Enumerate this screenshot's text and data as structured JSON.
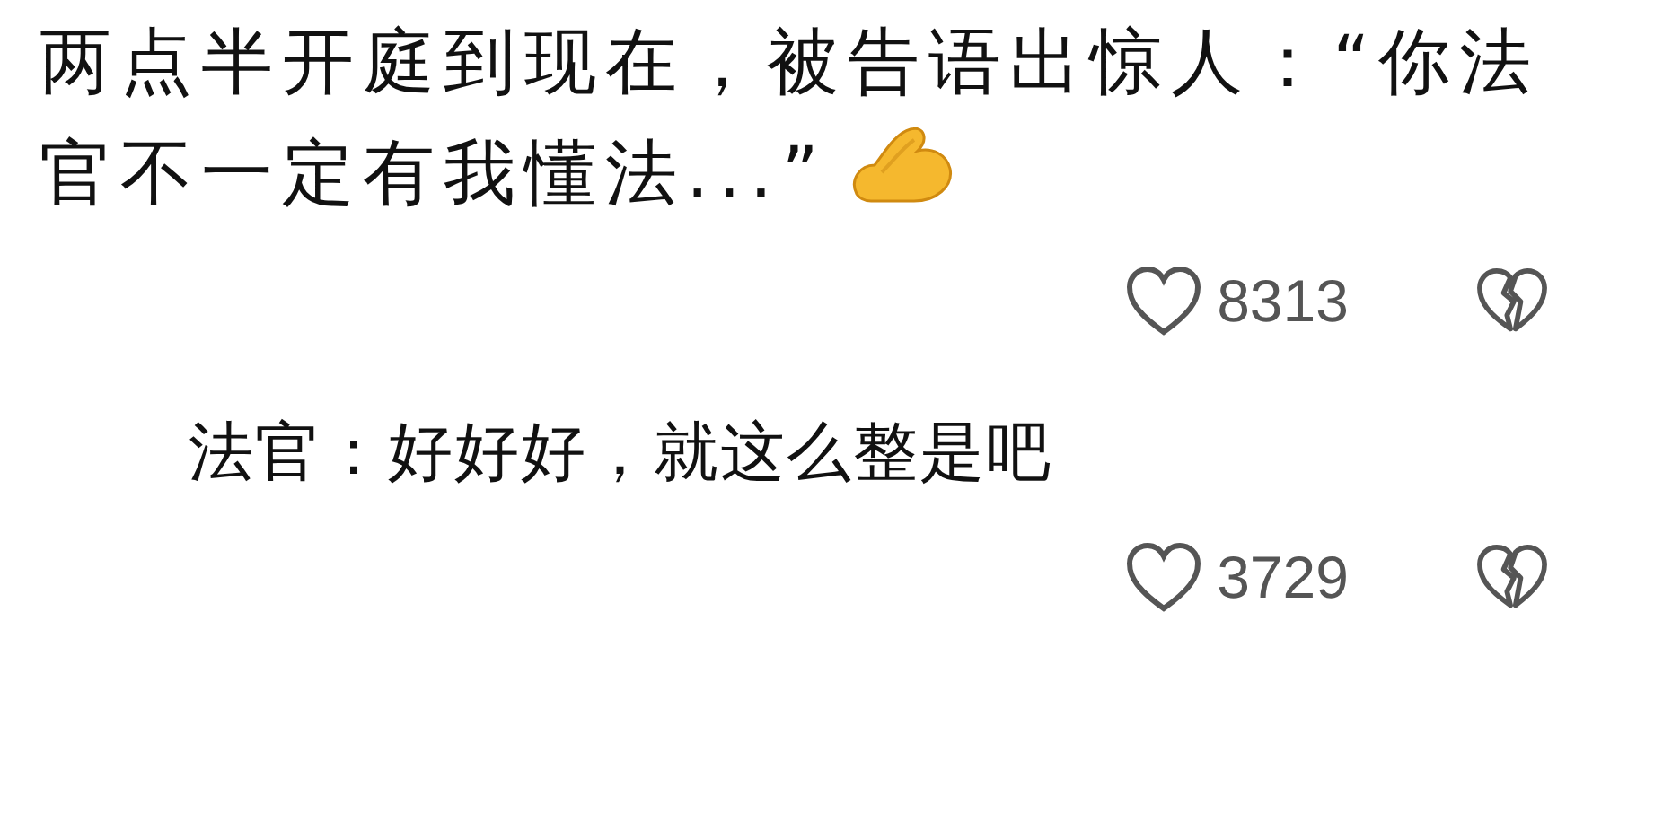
{
  "comments": [
    {
      "kind": "comment",
      "lines": [
        "两点半开庭到现在，被告语出惊人：“你法",
        "官不一定有我懂法...”"
      ],
      "likes": "8313"
    },
    {
      "kind": "reply",
      "lines": [
        "法官：好好好，就这么整是吧"
      ],
      "likes": "3729"
    }
  ]
}
